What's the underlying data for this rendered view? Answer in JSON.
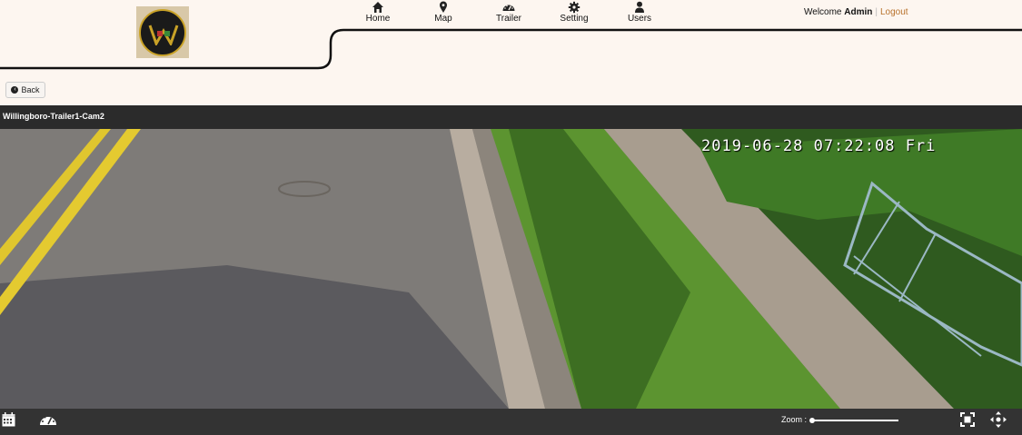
{
  "nav": {
    "items": [
      {
        "label": "Home",
        "icon": "home-icon"
      },
      {
        "label": "Map",
        "icon": "map-marker-icon"
      },
      {
        "label": "Trailer",
        "icon": "dashboard-icon"
      },
      {
        "label": "Setting",
        "icon": "gear-icon"
      },
      {
        "label": "Users",
        "icon": "user-icon"
      }
    ]
  },
  "user": {
    "welcome": "Welcome",
    "name": "Admin",
    "separator": "|",
    "logout": "Logout"
  },
  "back": {
    "label": "Back"
  },
  "camera": {
    "title": "Willingboro-Trailer1-Cam2",
    "timestamp": "2019-06-28 07:22:08 Fri"
  },
  "controls": {
    "zoom_label": "Zoom :",
    "zoom_level": 0
  },
  "colors": {
    "background": "#fdf6f0",
    "bar": "#2b2b2b",
    "logout": "#b8722c"
  }
}
